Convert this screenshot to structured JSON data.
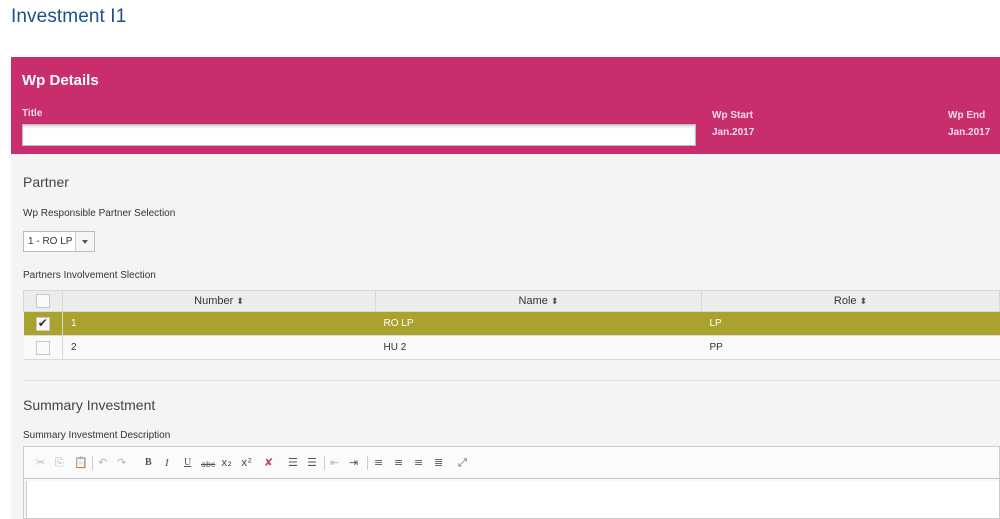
{
  "page": {
    "title": "Investment I1"
  },
  "wp_details": {
    "header": "Wp Details",
    "title_label": "Title",
    "title_value": "",
    "wp_start_label": "Wp Start",
    "wp_start_value": "Jan.2017",
    "wp_end_label": "Wp End",
    "wp_end_value": "Jan.2017",
    "color": "#c82d6d"
  },
  "partner": {
    "section_title": "Partner",
    "responsible_label": "Wp Responsible Partner Selection",
    "responsible_selected": "1 - RO LP",
    "involvement_label": "Partners Involvement Slection",
    "columns": [
      "Number",
      "Name",
      "Role"
    ],
    "rows": [
      {
        "checked": true,
        "number": "1",
        "name": "RO LP",
        "role": "LP"
      },
      {
        "checked": false,
        "number": "2",
        "name": "HU 2",
        "role": "PP"
      }
    ],
    "selected_row_color": "#a9a32e"
  },
  "summary": {
    "section_title": "Summary Investment",
    "description_label": "Summary Investment Description",
    "description_value": ""
  },
  "editor_toolbar": {
    "icons": [
      "cut-icon",
      "copy-icon",
      "paste-text-icon",
      "undo-icon",
      "redo-icon",
      "bold-icon",
      "italic-icon",
      "underline-icon",
      "strikethrough-icon",
      "subscript-icon",
      "superscript-icon",
      "remove-format-icon",
      "numbered-list-icon",
      "bulleted-list-icon",
      "outdent-icon",
      "indent-icon",
      "align-left-icon",
      "align-center-icon",
      "align-right-icon",
      "justify-icon",
      "maximize-icon"
    ]
  }
}
